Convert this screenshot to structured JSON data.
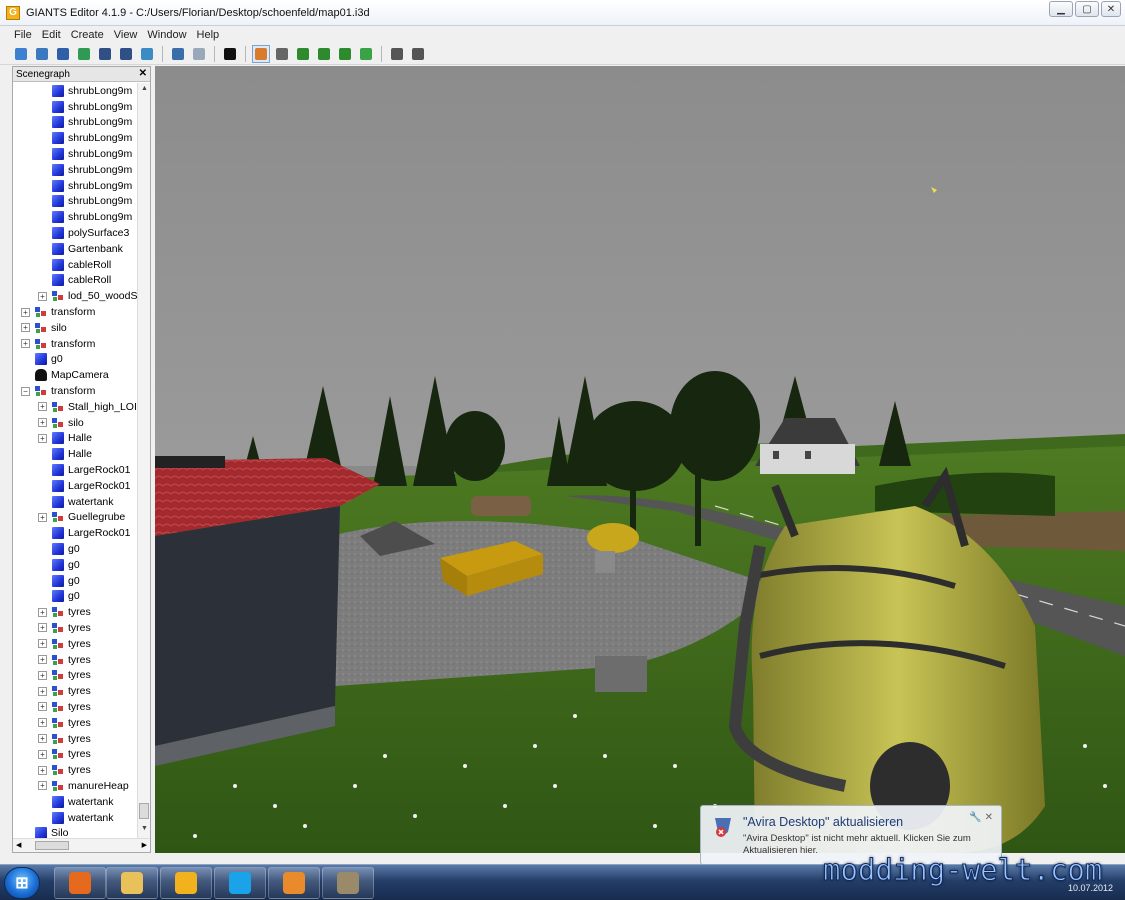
{
  "window": {
    "title": "GIANTS Editor 4.1.9 - C:/Users/Florian/Desktop/schoenfeld/map01.i3d",
    "controls": {
      "minimize": "▁",
      "maximize": "▢",
      "close": "✕"
    }
  },
  "menu": [
    "File",
    "Edit",
    "Create",
    "View",
    "Window",
    "Help"
  ],
  "toolbar_icons": [
    {
      "name": "new-icon",
      "color": "#3d7fd0"
    },
    {
      "name": "open-icon",
      "color": "#3a78c0"
    },
    {
      "name": "import-icon",
      "color": "#2f5fa8"
    },
    {
      "name": "refresh-icon",
      "color": "#2e9a52"
    },
    {
      "name": "save-icon",
      "color": "#2f4f86"
    },
    {
      "name": "save-all-icon",
      "color": "#2f4f86"
    },
    {
      "name": "export-icon",
      "color": "#3b8bc4"
    },
    {
      "name": "undo-icon",
      "color": "#3a6ea8"
    },
    {
      "name": "redo-icon",
      "color": "#9aa9b9"
    },
    {
      "name": "play-icon",
      "color": "#111111"
    },
    {
      "name": "select-icon",
      "color": "#d97b2a"
    },
    {
      "name": "magnet-icon",
      "color": "#666666"
    },
    {
      "name": "terrain-raise-icon",
      "color": "#2d8a2d"
    },
    {
      "name": "terrain-paint-icon",
      "color": "#2d8a2d"
    },
    {
      "name": "terrain-smooth-icon",
      "color": "#2d8a2d"
    },
    {
      "name": "foliage-icon",
      "color": "#3aa346"
    },
    {
      "name": "particle-icon",
      "color": "#555555"
    },
    {
      "name": "particle-settings-icon",
      "color": "#555555"
    }
  ],
  "scenegraph": {
    "title": "Scenegraph",
    "close": "✕",
    "nodes": [
      {
        "label": "shrubLong9m",
        "icon": "cube",
        "depth": 2,
        "expand": false
      },
      {
        "label": "shrubLong9m",
        "icon": "cube",
        "depth": 2,
        "expand": false
      },
      {
        "label": "shrubLong9m",
        "icon": "cube",
        "depth": 2,
        "expand": false
      },
      {
        "label": "shrubLong9m",
        "icon": "cube",
        "depth": 2,
        "expand": false
      },
      {
        "label": "shrubLong9m",
        "icon": "cube",
        "depth": 2,
        "expand": false
      },
      {
        "label": "shrubLong9m",
        "icon": "cube",
        "depth": 2,
        "expand": false
      },
      {
        "label": "shrubLong9m",
        "icon": "cube",
        "depth": 2,
        "expand": false
      },
      {
        "label": "shrubLong9m",
        "icon": "cube",
        "depth": 2,
        "expand": false
      },
      {
        "label": "shrubLong9m",
        "icon": "cube",
        "depth": 2,
        "expand": false
      },
      {
        "label": "polySurface3",
        "icon": "cube",
        "depth": 2,
        "expand": false
      },
      {
        "label": "Gartenbank",
        "icon": "cube",
        "depth": 2,
        "expand": false
      },
      {
        "label": "cableRoll",
        "icon": "cube",
        "depth": 2,
        "expand": false
      },
      {
        "label": "cableRoll",
        "icon": "cube",
        "depth": 2,
        "expand": false
      },
      {
        "label": "lod_50_woodS",
        "icon": "xform",
        "depth": 2,
        "expand": true
      },
      {
        "label": "transform",
        "icon": "xform",
        "depth": 1,
        "expand": true
      },
      {
        "label": "silo",
        "icon": "xform",
        "depth": 1,
        "expand": true
      },
      {
        "label": "transform",
        "icon": "xform",
        "depth": 1,
        "expand": true
      },
      {
        "label": "g0",
        "icon": "cube",
        "depth": 1,
        "expand": false
      },
      {
        "label": "MapCamera",
        "icon": "cam",
        "depth": 1,
        "expand": false
      },
      {
        "label": "transform",
        "icon": "xform",
        "depth": 1,
        "expand": true,
        "open": true
      },
      {
        "label": "Stall_high_LOI",
        "icon": "xform",
        "depth": 2,
        "expand": true
      },
      {
        "label": "silo",
        "icon": "xform",
        "depth": 2,
        "expand": true
      },
      {
        "label": "Halle",
        "icon": "cube",
        "depth": 2,
        "expand": true
      },
      {
        "label": "Halle",
        "icon": "cube",
        "depth": 2,
        "expand": false
      },
      {
        "label": "LargeRock01",
        "icon": "cube",
        "depth": 2,
        "expand": false
      },
      {
        "label": "LargeRock01",
        "icon": "cube",
        "depth": 2,
        "expand": false
      },
      {
        "label": "watertank",
        "icon": "cube",
        "depth": 2,
        "expand": false
      },
      {
        "label": "Guellegrube",
        "icon": "xform",
        "depth": 2,
        "expand": true
      },
      {
        "label": "LargeRock01",
        "icon": "cube",
        "depth": 2,
        "expand": false
      },
      {
        "label": "g0",
        "icon": "cube",
        "depth": 2,
        "expand": false
      },
      {
        "label": "g0",
        "icon": "cube",
        "depth": 2,
        "expand": false
      },
      {
        "label": "g0",
        "icon": "cube",
        "depth": 2,
        "expand": false
      },
      {
        "label": "g0",
        "icon": "cube",
        "depth": 2,
        "expand": false
      },
      {
        "label": "tyres",
        "icon": "xform",
        "depth": 2,
        "expand": true
      },
      {
        "label": "tyres",
        "icon": "xform",
        "depth": 2,
        "expand": true
      },
      {
        "label": "tyres",
        "icon": "xform",
        "depth": 2,
        "expand": true
      },
      {
        "label": "tyres",
        "icon": "xform",
        "depth": 2,
        "expand": true
      },
      {
        "label": "tyres",
        "icon": "xform",
        "depth": 2,
        "expand": true
      },
      {
        "label": "tyres",
        "icon": "xform",
        "depth": 2,
        "expand": true
      },
      {
        "label": "tyres",
        "icon": "xform",
        "depth": 2,
        "expand": true
      },
      {
        "label": "tyres",
        "icon": "xform",
        "depth": 2,
        "expand": true
      },
      {
        "label": "tyres",
        "icon": "xform",
        "depth": 2,
        "expand": true
      },
      {
        "label": "tyres",
        "icon": "xform",
        "depth": 2,
        "expand": true
      },
      {
        "label": "tyres",
        "icon": "xform",
        "depth": 2,
        "expand": true
      },
      {
        "label": "manureHeap",
        "icon": "xform",
        "depth": 2,
        "expand": true
      },
      {
        "label": "watertank",
        "icon": "cube",
        "depth": 2,
        "expand": false
      },
      {
        "label": "watertank",
        "icon": "cube",
        "depth": 2,
        "expand": false
      },
      {
        "label": "Silo",
        "icon": "cube",
        "depth": 1,
        "expand": false
      }
    ]
  },
  "notification": {
    "title": "\"Avira Desktop\" aktualisieren",
    "body": "\"Avira Desktop\" ist nicht mehr aktuell. Klicken Sie zum Aktualisieren hier.",
    "icons": "🔧 ✕"
  },
  "taskbar": {
    "start_label": "⊞",
    "apps": [
      {
        "name": "firefox-icon",
        "color": "#e66a1e"
      },
      {
        "name": "explorer-folder-icon",
        "color": "#e8c15a"
      },
      {
        "name": "giants-editor-icon",
        "color": "#f2b21d"
      },
      {
        "name": "skype-icon",
        "color": "#1aa3e8"
      },
      {
        "name": "media-player-icon",
        "color": "#e98a2c"
      },
      {
        "name": "gimp-icon",
        "color": "#9a8a6a"
      }
    ],
    "date": "10.07.2012"
  },
  "watermark": "modding-welt.com"
}
